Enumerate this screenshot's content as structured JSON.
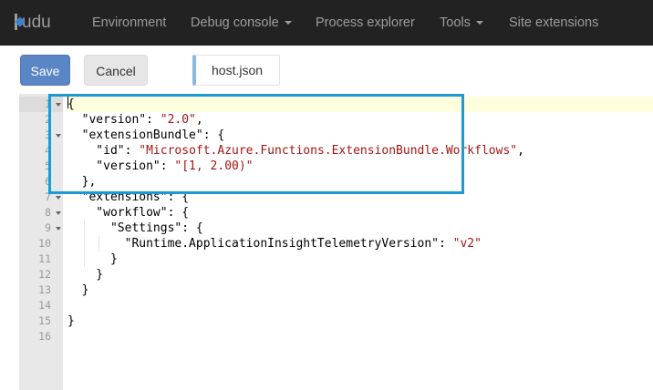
{
  "navbar": {
    "brand": "udu",
    "items": [
      {
        "label": "Environment",
        "dropdown": false
      },
      {
        "label": "Debug console",
        "dropdown": true
      },
      {
        "label": "Process explorer",
        "dropdown": false
      },
      {
        "label": "Tools",
        "dropdown": true
      },
      {
        "label": "Site extensions",
        "dropdown": false
      }
    ]
  },
  "toolbar": {
    "save_label": "Save",
    "cancel_label": "Cancel",
    "file_name": "host.json"
  },
  "editor": {
    "active_line": 1,
    "highlighted_lines": [
      7,
      13
    ],
    "lines": [
      {
        "num": "1",
        "fold": true,
        "text": "{"
      },
      {
        "num": "2",
        "fold": false,
        "text": "  \"version\": \"2.0\","
      },
      {
        "num": "3",
        "fold": true,
        "text": "  \"extensionBundle\": {"
      },
      {
        "num": "4",
        "fold": false,
        "text": "    \"id\": \"Microsoft.Azure.Functions.ExtensionBundle.Workflows\","
      },
      {
        "num": "5",
        "fold": false,
        "text": "    \"version\": \"[1, 2.00)\""
      },
      {
        "num": "6",
        "fold": false,
        "text": "  },"
      },
      {
        "num": "7",
        "fold": true,
        "text": "  \"extensions\": {"
      },
      {
        "num": "8",
        "fold": true,
        "text": "    \"workflow\": {"
      },
      {
        "num": "9",
        "fold": true,
        "text": "      \"Settings\": {"
      },
      {
        "num": "10",
        "fold": false,
        "text": "        \"Runtime.ApplicationInsightTelemetryVersion\": \"v2\""
      },
      {
        "num": "11",
        "fold": false,
        "text": "      }"
      },
      {
        "num": "12",
        "fold": false,
        "text": "    }"
      },
      {
        "num": "13",
        "fold": false,
        "text": "  }"
      },
      {
        "num": "14",
        "fold": false,
        "text": ""
      },
      {
        "num": "15",
        "fold": false,
        "text": "}"
      },
      {
        "num": "16",
        "fold": false,
        "text": ""
      }
    ]
  },
  "colors": {
    "navbar_bg": "#222222",
    "nav_text": "#9d9d9d",
    "brand_accent": "#3c7fcf",
    "save_button": "#5b86c6",
    "string_value": "#a31515",
    "highlight_box": "#1a9ad6",
    "active_line_bg": "#ffffdd"
  }
}
